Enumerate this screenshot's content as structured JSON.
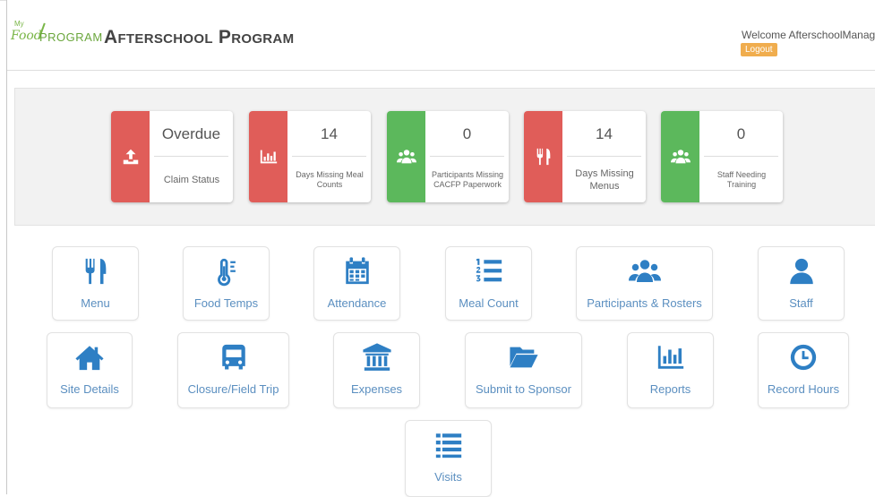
{
  "header": {
    "logo": {
      "my": "My",
      "food": "Food",
      "program": "PROGRAM"
    },
    "title": "Afterschool Program",
    "welcome": "Welcome AfterschoolManage",
    "logout_label": "Logout"
  },
  "status_cards": [
    {
      "value": "Overdue",
      "label": "Claim Status",
      "color": "#e05d59",
      "icon": "upload-icon"
    },
    {
      "value": "14",
      "label": "Days Missing Meal Counts",
      "color": "#e05d59",
      "icon": "bar-chart-icon"
    },
    {
      "value": "0",
      "label": "Participants Missing CACFP Paperwork",
      "color": "#5cb85c",
      "icon": "users-icon"
    },
    {
      "value": "14",
      "label": "Days Missing Menus",
      "color": "#e05d59",
      "icon": "utensils-icon"
    },
    {
      "value": "0",
      "label": "Staff Needing Training",
      "color": "#5cb85c",
      "icon": "users-icon"
    }
  ],
  "tiles": [
    {
      "label": "Menu",
      "icon": "utensils-icon"
    },
    {
      "label": "Food Temps",
      "icon": "thermometer-icon"
    },
    {
      "label": "Attendance",
      "icon": "calendar-icon"
    },
    {
      "label": "Meal Count",
      "icon": "numbered-list-icon"
    },
    {
      "label": "Participants & Rosters",
      "icon": "users-icon"
    },
    {
      "label": "Staff",
      "icon": "user-icon"
    },
    {
      "label": "Site Details",
      "icon": "home-icon"
    },
    {
      "label": "Closure/Field Trip",
      "icon": "bus-icon"
    },
    {
      "label": "Expenses",
      "icon": "bank-icon"
    },
    {
      "label": "Submit to Sponsor",
      "icon": "folder-open-icon"
    },
    {
      "label": "Reports",
      "icon": "bar-chart-icon"
    },
    {
      "label": "Record Hours",
      "icon": "clock-icon"
    },
    {
      "label": "Visits",
      "icon": "list-icon"
    }
  ],
  "colors": {
    "accent": "#2e7fc4",
    "danger": "#e05d59",
    "success": "#5cb85c",
    "warning": "#f0ad4e"
  }
}
